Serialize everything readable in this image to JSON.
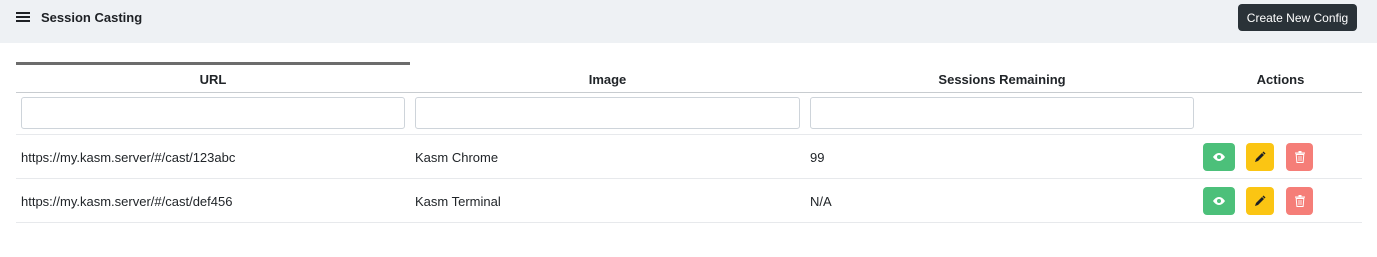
{
  "header": {
    "title": "Session Casting",
    "menu_icon": "hamburger-icon",
    "create_button_label": "Create New Config"
  },
  "table": {
    "columns": [
      {
        "label": "URL",
        "sorted": true
      },
      {
        "label": "Image",
        "sorted": false
      },
      {
        "label": "Sessions Remaining",
        "sorted": false
      },
      {
        "label": "Actions",
        "sorted": false
      }
    ],
    "filters": {
      "url_placeholder": "",
      "image_placeholder": "",
      "sessions_placeholder": ""
    },
    "rows": [
      {
        "url": "https://my.kasm.server/#/cast/123abc",
        "image": "Kasm Chrome",
        "sessions_remaining": "99",
        "actions": [
          "eye-icon",
          "pencil-icon",
          "trash-icon"
        ]
      },
      {
        "url": "https://my.kasm.server/#/cast/def456",
        "image": "Kasm Terminal",
        "sessions_remaining": "N/A",
        "actions": [
          "eye-icon",
          "pencil-icon",
          "trash-icon"
        ]
      }
    ]
  },
  "colors": {
    "header_bg": "#eef1f4",
    "create_button_bg": "#2a3238",
    "view_button": "#4cc07a",
    "edit_button": "#fbc513",
    "delete_button": "#f57e78"
  }
}
